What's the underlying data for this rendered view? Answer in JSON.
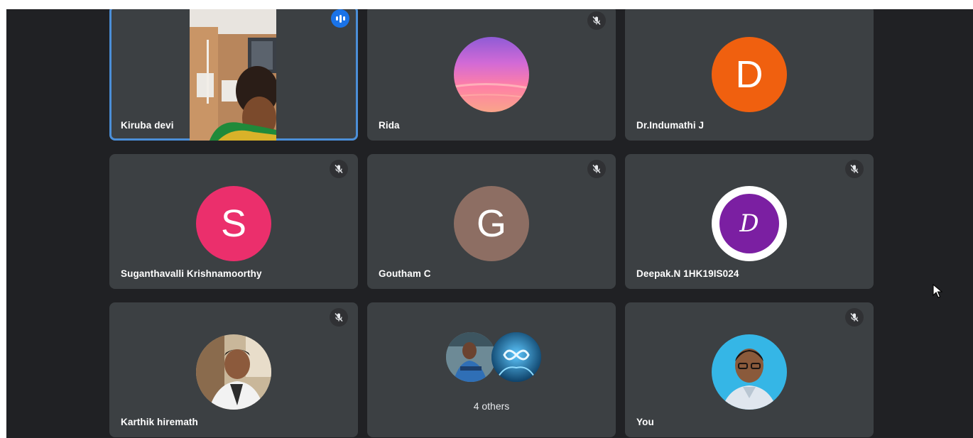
{
  "participants": [
    {
      "name": "Kiruba devi",
      "status": "speaking",
      "avatar": "camera-video"
    },
    {
      "name": "Rida",
      "status": "muted",
      "avatar": "sunset-photo"
    },
    {
      "name": "Dr.Indumathi J",
      "status": "",
      "avatar_letter": "D",
      "color": "#f0600f"
    },
    {
      "name": "Suganthavalli Krishnamoorthy",
      "status": "muted",
      "avatar_letter": "S",
      "color": "#eb2f6c"
    },
    {
      "name": "Goutham C",
      "status": "muted",
      "avatar_letter": "G",
      "color": "#8d6e63"
    },
    {
      "name": "Deepak.N 1HK19IS024",
      "status": "muted",
      "avatar_letter": "D",
      "color": "#7b1fa2"
    },
    {
      "name": "Karthik hiremath",
      "status": "muted",
      "avatar": "profile-photo"
    },
    {
      "others_label": "4 others",
      "avatar": "grouped-avatars"
    },
    {
      "name": "You",
      "status": "muted",
      "avatar": "profile-photo"
    }
  ],
  "icons": {
    "muted": "mic-off-icon",
    "speaking": "audio-level-icon",
    "pointer": "mouse-cursor-icon"
  }
}
